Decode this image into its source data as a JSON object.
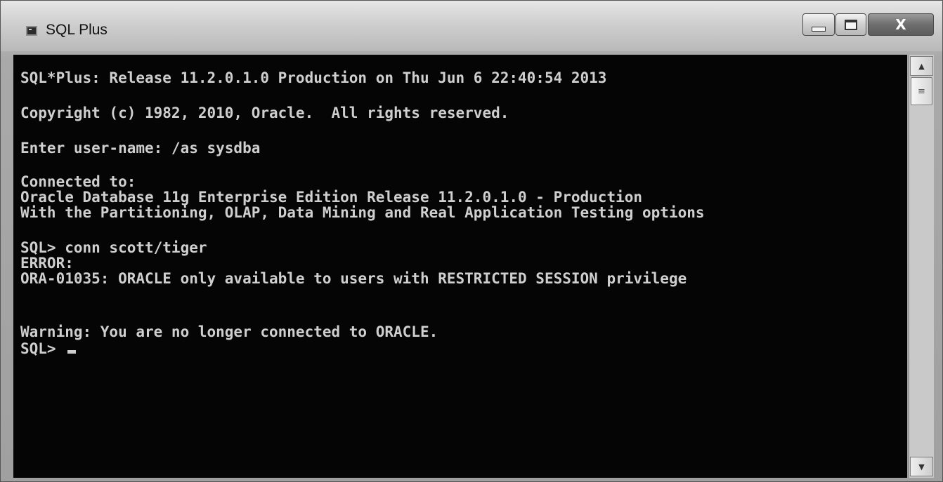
{
  "window": {
    "title": "SQL Plus",
    "close_label": "X"
  },
  "console": {
    "lines": [
      "SQL*Plus: Release 11.2.0.1.0 Production on Thu Jun 6 22:40:54 2013",
      "Copyright (c) 1982, 2010, Oracle.  All rights reserved.",
      "Enter user-name: /as sysdba",
      "Connected to:",
      "Oracle Database 11g Enterprise Edition Release 11.2.0.1.0 - Production",
      "With the Partitioning, OLAP, Data Mining and Real Application Testing options",
      "SQL> conn scott/tiger",
      "ERROR:",
      "ORA-01035: ORACLE only available to users with RESTRICTED SESSION privilege",
      "Warning: You are no longer connected to ORACLE.",
      "SQL> "
    ]
  },
  "scrollbar": {
    "up_glyph": "▲",
    "down_glyph": "▼",
    "thumb_glyph": "≡"
  },
  "icons": {
    "app": "console-app-icon",
    "minimize": "minimize-icon",
    "maximize": "maximize-icon",
    "close": "close-icon"
  }
}
